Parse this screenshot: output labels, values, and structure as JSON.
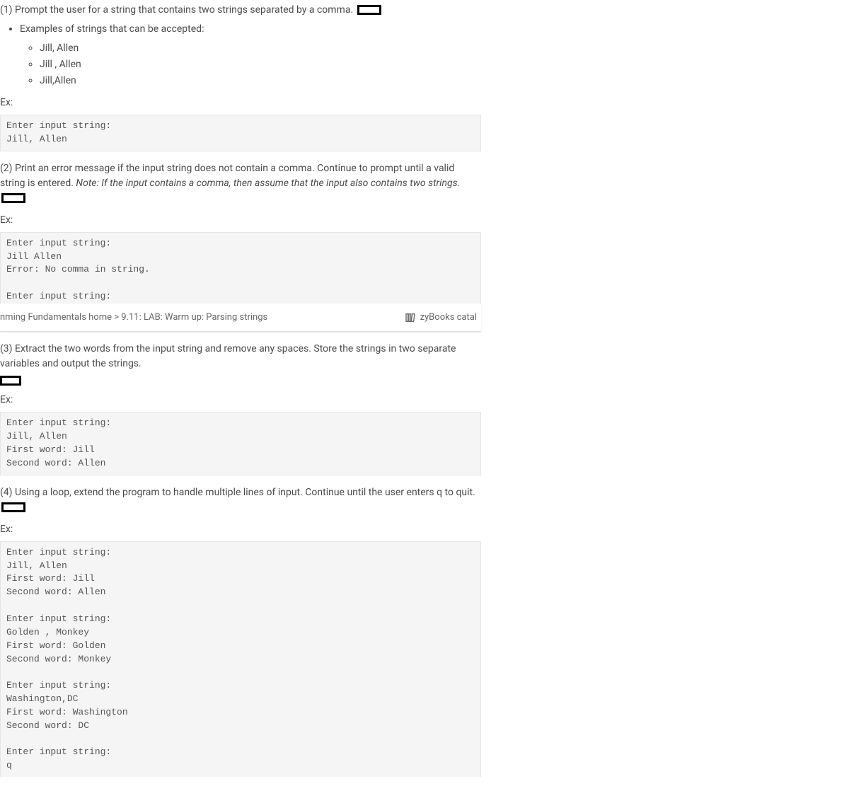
{
  "step1": {
    "text": "(1) Prompt the user for a string that contains two strings separated by a comma.",
    "examples_intro": "Examples of strings that can be accepted:",
    "examples": [
      "Jill, Allen",
      "Jill , Allen",
      "Jill,Allen"
    ],
    "ex_label": "Ex:",
    "code": "Enter input string:\nJill, Allen"
  },
  "step2": {
    "text_a": "(2) Print an error message if the input string does not contain a comma. Continue to prompt until a valid string is entered. ",
    "note": "Note: If the input contains a comma, then assume that the input also contains two strings.",
    "ex_label": "Ex:",
    "code": "Enter input string:\nJill Allen\nError: No comma in string.\n\nEnter input string:"
  },
  "nav": {
    "breadcrumb": "nming Fundamentals home > 9.11: LAB: Warm up: Parsing strings",
    "catalog": "zyBooks catal"
  },
  "step3": {
    "text": "(3) Extract the two words from the input string and remove any spaces. Store the strings in two separate variables and output the strings.",
    "ex_label": "Ex:",
    "code": "Enter input string:\nJill, Allen\nFirst word: Jill\nSecond word: Allen"
  },
  "step4": {
    "text": "(4) Using a loop, extend the program to handle multiple lines of input. Continue until the user enters q to quit.",
    "ex_label": "Ex:",
    "code": "Enter input string:\nJill, Allen\nFirst word: Jill\nSecond word: Allen\n\nEnter input string:\nGolden , Monkey\nFirst word: Golden\nSecond word: Monkey\n\nEnter input string:\nWashington,DC\nFirst word: Washington\nSecond word: DC\n\nEnter input string:\nq"
  }
}
